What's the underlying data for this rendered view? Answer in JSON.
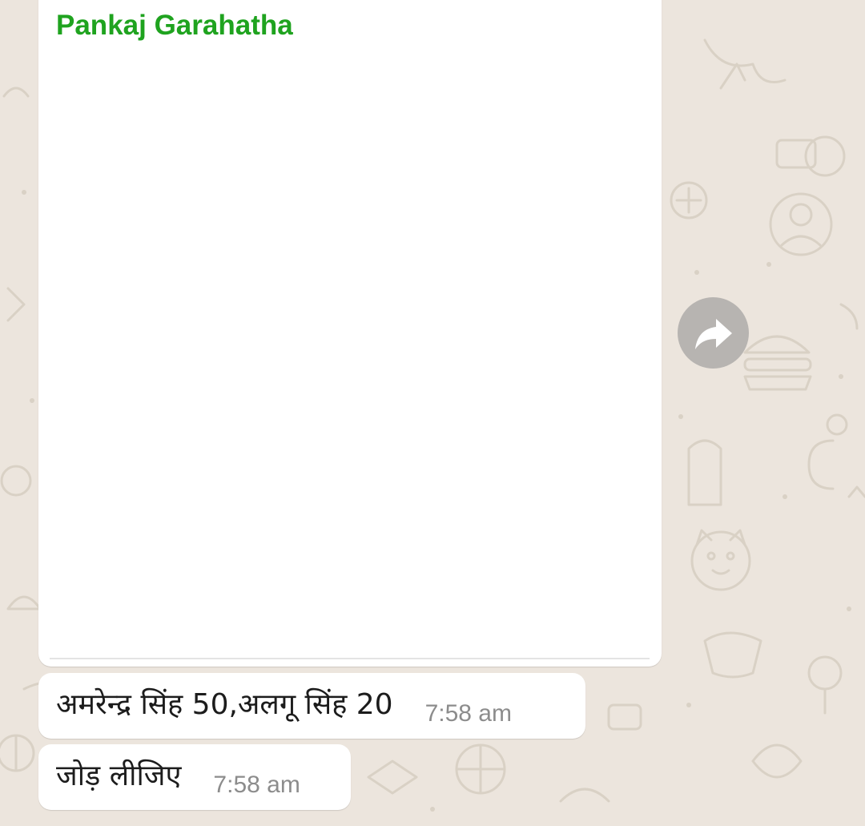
{
  "colors": {
    "chat_background": "#ece5dd",
    "doodle_stroke": "#d9d1c5",
    "bubble": "#ffffff",
    "sender_name": "#1fa31f",
    "message_text": "#1c1c1c",
    "timestamp": "#8c8c8c"
  },
  "image_message": {
    "sender": "Pankaj Garahatha",
    "icon": "forward-icon"
  },
  "messages": [
    {
      "text": "अमरेन्द्र सिंह 50,अलगू सिंह 20",
      "time": "7:58 am"
    },
    {
      "text": "जोड़ लीजिए",
      "time": "7:58 am"
    }
  ]
}
